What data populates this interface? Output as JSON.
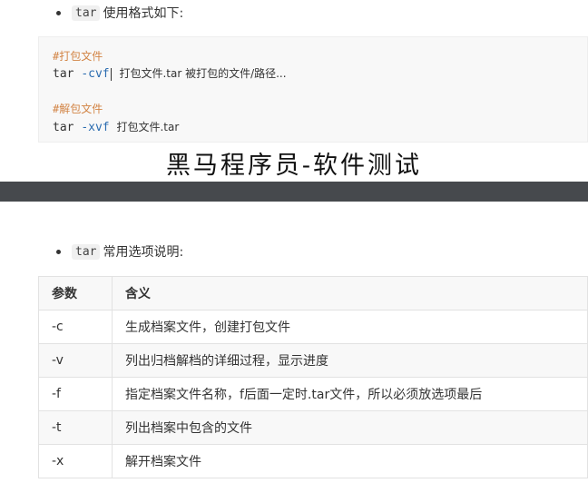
{
  "section1": {
    "inline_code": "tar",
    "intro_text": "使用格式如下:",
    "code_lines": {
      "comment_pack": "#打包文件",
      "pack_cmd": "tar",
      "pack_flag": "-cvf",
      "pack_args": "打包文件.tar 被打包的文件/路径...",
      "comment_unpack": "#解包文件",
      "unpack_cmd": "tar",
      "unpack_flag": "-xvf",
      "unpack_args": "打包文件.tar"
    }
  },
  "watermark": "黑马程序员-软件测试",
  "section2": {
    "inline_code": "tar",
    "intro_text": "常用选项说明:",
    "table": {
      "headers": [
        "参数",
        "含义"
      ],
      "rows": [
        [
          "-c",
          "生成档案文件，创建打包文件"
        ],
        [
          "-v",
          "列出归档解档的详细过程，显示进度"
        ],
        [
          "-f",
          "指定档案文件名称，f后面一定时.tar文件，所以必须放选项最后"
        ],
        [
          "-t",
          "列出档案中包含的文件"
        ],
        [
          "-x",
          "解开档案文件"
        ]
      ]
    }
  }
}
